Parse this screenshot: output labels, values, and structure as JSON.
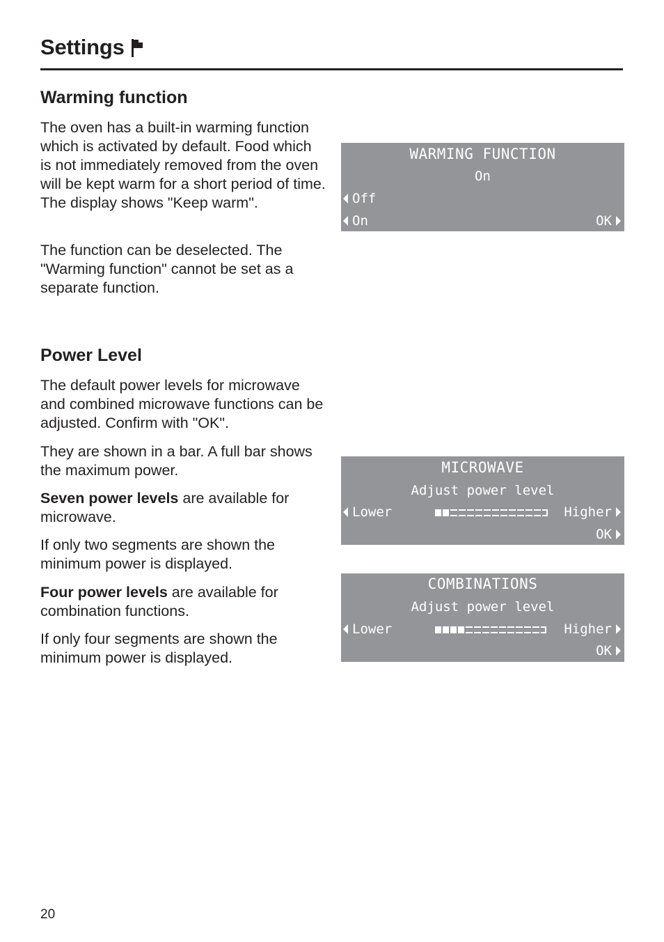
{
  "header": {
    "title": "Settings",
    "icon": "flag-icon"
  },
  "sections": [
    {
      "heading": "Warming function",
      "paragraphs": [
        "The oven has a built-in warming function which is activated by default. Food which is not immediately removed from the oven will be kept warm for a short period of time. The display shows \"Keep warm\".",
        "The function can be deselected. The \"Warming function\" cannot be set as a separate function."
      ]
    },
    {
      "heading": "Power Level",
      "paragraphs": [
        "The default power levels for microwave and combined microwave functions can be adjusted. Confirm with \"OK\".",
        "They are shown in a bar. A full bar shows the maximum power.",
        {
          "bold": "Seven power levels",
          "rest": " are available for microwave."
        },
        "If only two segments are shown the minimum power is displayed.",
        {
          "bold": "Four power levels",
          "rest": " are available for combination functions."
        },
        "If only four segments are shown the minimum power is displayed."
      ]
    }
  ],
  "displays": {
    "warming": {
      "title": "WARMING FUNCTION",
      "value": "On",
      "option_off": "Off",
      "option_on": "On",
      "ok": "OK"
    },
    "microwave": {
      "title": "MICROWAVE",
      "subtitle": "Adjust power level",
      "lower": "Lower",
      "higher": "Higher",
      "ok": "OK",
      "bar_filled_segments": 2,
      "bar_total_segments": 14
    },
    "combinations": {
      "title": "COMBINATIONS",
      "subtitle": "Adjust power level",
      "lower": "Lower",
      "higher": "Higher",
      "ok": "OK",
      "bar_filled_segments": 4,
      "bar_total_segments": 14
    },
    "colors": {
      "lcd_background": "#939598",
      "lcd_text": "#ffffff"
    }
  },
  "footer": {
    "page_number": "20"
  }
}
